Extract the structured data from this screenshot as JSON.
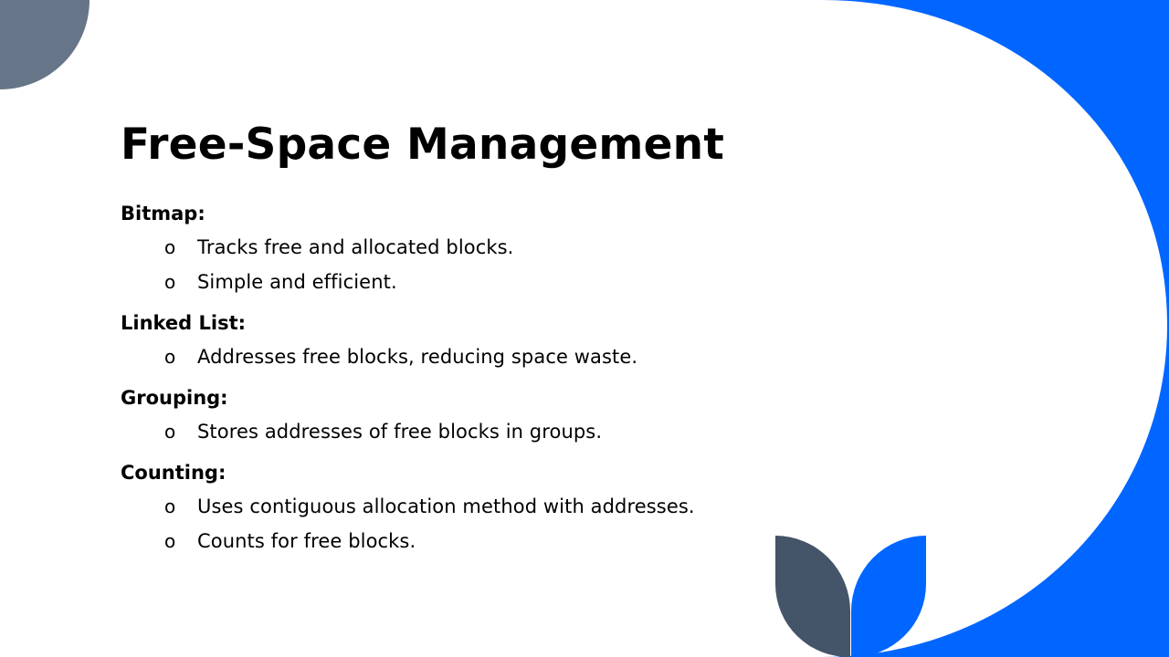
{
  "slide": {
    "title": "Free-Space Management",
    "sections": [
      {
        "heading": "Bitmap:",
        "bullets": [
          "Tracks free and allocated blocks.",
          "Simple and efficient."
        ]
      },
      {
        "heading": "Linked List:",
        "bullets": [
          "Addresses free blocks, reducing space waste."
        ]
      },
      {
        "heading": "Grouping:",
        "bullets": [
          "Stores addresses of free blocks in groups."
        ]
      },
      {
        "heading": "Counting:",
        "bullets": [
          "Uses contiguous allocation method with addresses.",
          "Counts for free blocks."
        ]
      }
    ],
    "bullet_marker": "o"
  },
  "colors": {
    "accent_blue": "#0066ff",
    "slate": "#445469",
    "slate_light": "#667587",
    "text": "#000000",
    "background": "#ffffff"
  }
}
